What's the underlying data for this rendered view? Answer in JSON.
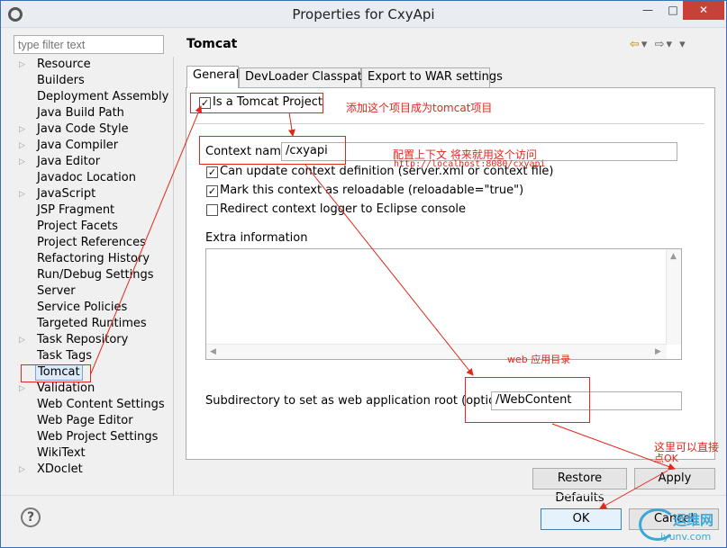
{
  "window": {
    "title": "Properties for CxyApi"
  },
  "filter": {
    "placeholder": "type filter text"
  },
  "tree": {
    "items": [
      {
        "label": "Resource",
        "arrow": true
      },
      {
        "label": "Builders",
        "arrow": false
      },
      {
        "label": "Deployment Assembly",
        "arrow": false
      },
      {
        "label": "Java Build Path",
        "arrow": false
      },
      {
        "label": "Java Code Style",
        "arrow": true
      },
      {
        "label": "Java Compiler",
        "arrow": true
      },
      {
        "label": "Java Editor",
        "arrow": true
      },
      {
        "label": "Javadoc Location",
        "arrow": false
      },
      {
        "label": "JavaScript",
        "arrow": true
      },
      {
        "label": "JSP Fragment",
        "arrow": false
      },
      {
        "label": "Project Facets",
        "arrow": false
      },
      {
        "label": "Project References",
        "arrow": false
      },
      {
        "label": "Refactoring History",
        "arrow": false
      },
      {
        "label": "Run/Debug Settings",
        "arrow": false
      },
      {
        "label": "Server",
        "arrow": false
      },
      {
        "label": "Service Policies",
        "arrow": false
      },
      {
        "label": "Targeted Runtimes",
        "arrow": false
      },
      {
        "label": "Task Repository",
        "arrow": true
      },
      {
        "label": "Task Tags",
        "arrow": false
      },
      {
        "label": "Tomcat",
        "arrow": false
      },
      {
        "label": "Validation",
        "arrow": true
      },
      {
        "label": "Web Content Settings",
        "arrow": false
      },
      {
        "label": "Web Page Editor",
        "arrow": false
      },
      {
        "label": "Web Project Settings",
        "arrow": false
      },
      {
        "label": "WikiText",
        "arrow": false
      },
      {
        "label": "XDoclet",
        "arrow": true
      }
    ],
    "selected_index": 19
  },
  "page": {
    "title": "Tomcat"
  },
  "tabs": [
    {
      "label": "General",
      "active": true
    },
    {
      "label": "DevLoader Classpath",
      "active": false
    },
    {
      "label": "Export to WAR settings",
      "active": false
    }
  ],
  "general": {
    "is_tomcat_project": {
      "label": "Is a Tomcat Project",
      "checked": true
    },
    "context_name": {
      "label": "Context name",
      "value": "/cxyapi"
    },
    "can_update": {
      "label": "Can update context definition (server.xml or context file)",
      "checked": true
    },
    "reloadable": {
      "label": "Mark this context as reloadable (reloadable=\"true\")",
      "checked": true
    },
    "redirect_logger": {
      "label": "Redirect context logger to Eclipse console",
      "checked": false
    },
    "extra_info": {
      "label": "Extra information",
      "value": ""
    },
    "subdir": {
      "label": "Subdirectory to set as web application root (optional)",
      "value": "/WebContent"
    }
  },
  "buttons": {
    "restore_defaults": "Restore Defaults",
    "apply": "Apply",
    "ok": "OK",
    "cancel": "Cancel"
  },
  "annotations": {
    "tomcat_project": "添加这个项目成为tomcat项目",
    "context": "配置上下文 将来就用这个访问",
    "context_url": "http://localhost:8080/cxyapi",
    "web_dir": "web 应用目录",
    "ok_hint_1": "这里可以直接",
    "ok_hint_2": "点OK"
  },
  "watermark": {
    "name": "运维网",
    "url": "iyunv.com"
  },
  "colors": {
    "annotation": "#e0281c",
    "selection": "#dcebfc",
    "accent": "#3c7fb1"
  }
}
